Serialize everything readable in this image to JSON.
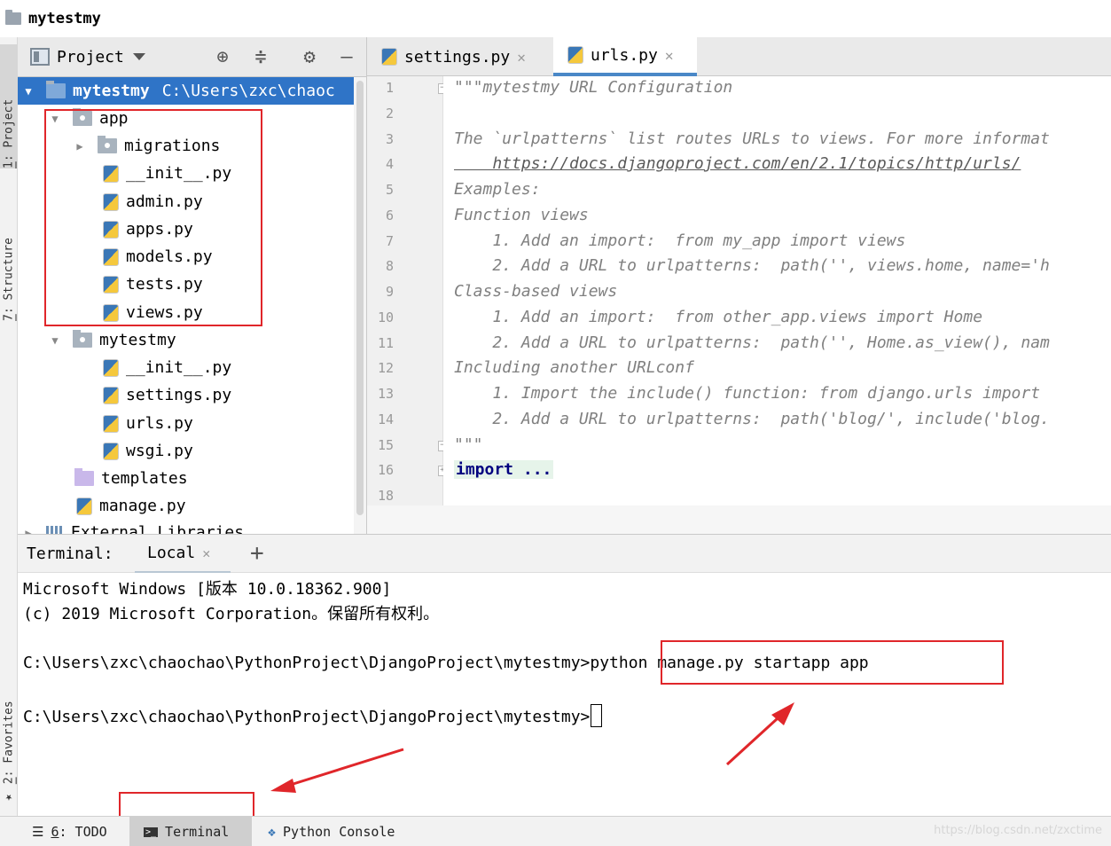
{
  "window": {
    "title": "mytestmy"
  },
  "left_stripe": {
    "project": {
      "num": "1",
      "label": ": Project"
    },
    "structure": {
      "num": "7",
      "label": ": Structure"
    },
    "favorites": {
      "num": "2",
      "label": ": Favorites"
    }
  },
  "project_panel": {
    "header_label": "Project",
    "icons": [
      "target-icon",
      "collapse-icon",
      "gear-icon",
      "minimize-icon"
    ],
    "tree": [
      {
        "name": "mytestmy",
        "path": "C:\\Users\\zxc\\chaoc",
        "kind": "root",
        "expanded": true
      },
      {
        "name": "app",
        "kind": "package",
        "expanded": true
      },
      {
        "name": "migrations",
        "kind": "package",
        "expanded": false
      },
      {
        "name": "__init__.py",
        "kind": "py"
      },
      {
        "name": "admin.py",
        "kind": "py"
      },
      {
        "name": "apps.py",
        "kind": "py"
      },
      {
        "name": "models.py",
        "kind": "py"
      },
      {
        "name": "tests.py",
        "kind": "py"
      },
      {
        "name": "views.py",
        "kind": "py"
      },
      {
        "name": "mytestmy",
        "kind": "package",
        "expanded": true
      },
      {
        "name": "__init__.py",
        "kind": "py"
      },
      {
        "name": "settings.py",
        "kind": "py"
      },
      {
        "name": "urls.py",
        "kind": "py"
      },
      {
        "name": "wsgi.py",
        "kind": "py"
      },
      {
        "name": "templates",
        "kind": "templates"
      },
      {
        "name": "manage.py",
        "kind": "py"
      },
      {
        "name": "External Libraries",
        "kind": "lib"
      }
    ]
  },
  "editor": {
    "tabs": [
      {
        "label": "settings.py",
        "active": false
      },
      {
        "label": "urls.py",
        "active": true
      }
    ],
    "lines": [
      {
        "n": "1",
        "text": "\"\"\"mytestmy URL Configuration"
      },
      {
        "n": "2",
        "text": ""
      },
      {
        "n": "3",
        "text": "The `urlpatterns` list routes URLs to views. For more informat"
      },
      {
        "n": "4",
        "text": "    https://docs.djangoproject.com/en/2.1/topics/http/urls/"
      },
      {
        "n": "5",
        "text": "Examples:"
      },
      {
        "n": "6",
        "text": "Function views"
      },
      {
        "n": "7",
        "text": "    1. Add an import:  from my_app import views"
      },
      {
        "n": "8",
        "text": "    2. Add a URL to urlpatterns:  path('', views.home, name='h"
      },
      {
        "n": "9",
        "text": "Class-based views"
      },
      {
        "n": "10",
        "text": "    1. Add an import:  from other_app.views import Home"
      },
      {
        "n": "11",
        "text": "    2. Add a URL to urlpatterns:  path('', Home.as_view(), nam"
      },
      {
        "n": "12",
        "text": "Including another URLconf"
      },
      {
        "n": "13",
        "text": "    1. Import the include() function: from django.urls import "
      },
      {
        "n": "14",
        "text": "    2. Add a URL to urlpatterns:  path('blog/', include('blog."
      },
      {
        "n": "15",
        "text": "\"\"\""
      },
      {
        "n": "16",
        "text": "import ..."
      },
      {
        "n": "18",
        "text": ""
      }
    ]
  },
  "terminal": {
    "label": "Terminal:",
    "tab": "Local",
    "add": "+",
    "lines": [
      "Microsoft Windows [版本 10.0.18362.900]",
      "(c) 2019 Microsoft Corporation。保留所有权利。",
      "",
      "C:\\Users\\zxc\\chaochao\\PythonProject\\DjangoProject\\mytestmy>python manage.py startapp app",
      "",
      "C:\\Users\\zxc\\chaochao\\PythonProject\\DjangoProject\\mytestmy>"
    ]
  },
  "bottom_bar": {
    "todo": {
      "num": "6",
      "label": ": TODO"
    },
    "terminal": "Terminal",
    "python_console": "Python Console",
    "watermark": "https://blog.csdn.net/zxctime"
  },
  "colors": {
    "selection": "#2f74c7",
    "annotation": "#e0262a",
    "comment": "#808080"
  }
}
